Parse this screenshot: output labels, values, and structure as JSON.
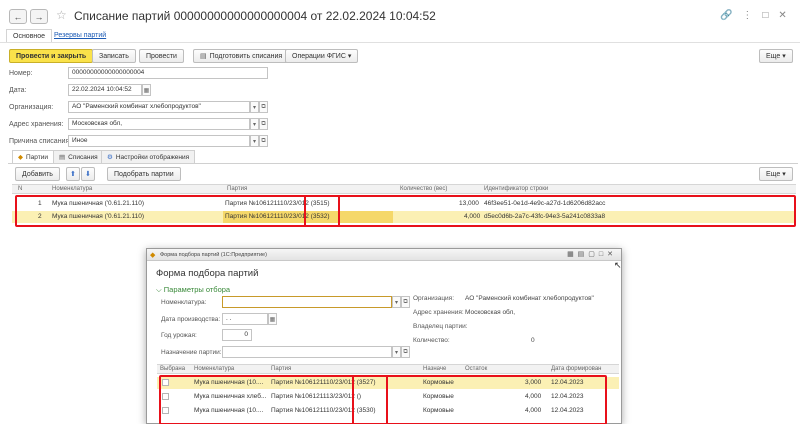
{
  "window": {
    "title": "Списание партий 00000000000000000004 от 22.02.2024 10:04:52",
    "back_glyph": "←",
    "forward_glyph": "→",
    "star_glyph": "☆",
    "link_icon": "🔗",
    "more_icon": "⋮",
    "maximize_icon": "□",
    "close_icon": "✕"
  },
  "tabs": {
    "main": "Основное",
    "reserves": "Резервы партий"
  },
  "toolbar": {
    "post_close": "Провести и закрыть",
    "save": "Записать",
    "post": "Провести",
    "prepare": "Подготовить списания",
    "fgis": "Операции ФГИС",
    "fgis_arrow": "▾",
    "more": "Еще",
    "more_arrow": "▾"
  },
  "form": {
    "number_label": "Номер:",
    "number_value": "00000000000000000004",
    "date_label": "Дата:",
    "date_value": "22.02.2024 10:04:52",
    "org_label": "Организация:",
    "org_value": "АО \"Раменский комбинат хлебопродуктов\"",
    "address_label": "Адрес хранения:",
    "address_value": "Московская обл,",
    "reason_label": "Причина списания:",
    "reason_value": "Иное"
  },
  "subtabs": {
    "batches": "Партии",
    "writeoffs": "Списания",
    "display": "Настройки отображения"
  },
  "table_toolbar": {
    "add": "Добавить",
    "up": "⬆",
    "down": "⬇",
    "pick": "Подобрать партии",
    "more": "Еще",
    "more_arrow": "▾"
  },
  "table": {
    "headers": {
      "n": "N",
      "nomenclature": "Номенклатура",
      "batch": "Партия",
      "qty": "Количество (вес)",
      "id": "Идентификатор строки"
    },
    "rows": [
      {
        "n": "1",
        "nomenclature": "Мука пшеничная ('0.61.21.110)",
        "batch": "Партия №106121110/23/012 (3515)",
        "qty": "13,000",
        "id": "46f3ee51-0e1d-4e9c-a27d-1d6206d82acc"
      },
      {
        "n": "2",
        "nomenclature": "Мука пшеничная ('0.61.21.110)",
        "batch": "Партия №106121110/23/012 (3532)",
        "qty": "4,000",
        "id": "d5ec0d6b-2a7c-43fc-94e3-5a241c0833a8"
      }
    ]
  },
  "dialog": {
    "window_title": "Форма подбора партий (1С:Предприятие)",
    "heading": "Форма подбора партий",
    "filter_group": "Параметры отбора",
    "fields": {
      "nomenclature_label": "Номенклатура:",
      "nomenclature_value": "",
      "prod_date_label": "Дата производства:",
      "prod_date_value": ".  .",
      "harvest_year_label": "Год урожая:",
      "harvest_year_value": "0",
      "purpose_label": "Назначение партии:",
      "purpose_value": ""
    },
    "info": {
      "org_label": "Организация:",
      "org_value": "АО \"Раменский комбинат хлебопродуктов\"",
      "address_label": "Адрес хранения:",
      "address_value": "Московская обл,",
      "owner_label": "Владелец партии:",
      "owner_value": "",
      "qty_label": "Количество:",
      "qty_value": "0"
    },
    "table": {
      "headers": {
        "selected": "Выбрана",
        "nomenclature": "Номенклатура",
        "batch": "Партия",
        "purpose": "Назначе",
        "remaining": "Остаток",
        "formed": "Дата формирован"
      },
      "rows": [
        {
          "nomenclature": "Мука пшеничная (10....",
          "batch": "Партия №106121110/23/012 (3527)",
          "purpose": "Кормовые",
          "remaining": "3,000",
          "date": "12.04.2023"
        },
        {
          "nomenclature": "Мука пшеничная хлеб...",
          "batch": "Партия №106121113/23/012 ()",
          "purpose": "Кормовые",
          "remaining": "4,000",
          "date": "12.04.2023"
        },
        {
          "nomenclature": "Мука пшеничная (10....",
          "batch": "Партия №106121110/23/012 (3530)",
          "purpose": "Кормовые",
          "remaining": "4,000",
          "date": "12.04.2023"
        }
      ]
    }
  },
  "colors": {
    "accent_yellow": "#fae24a",
    "highlight_red": "#e8101a",
    "link_blue": "#1c5bb5",
    "filter_green": "#3a8a3a"
  }
}
